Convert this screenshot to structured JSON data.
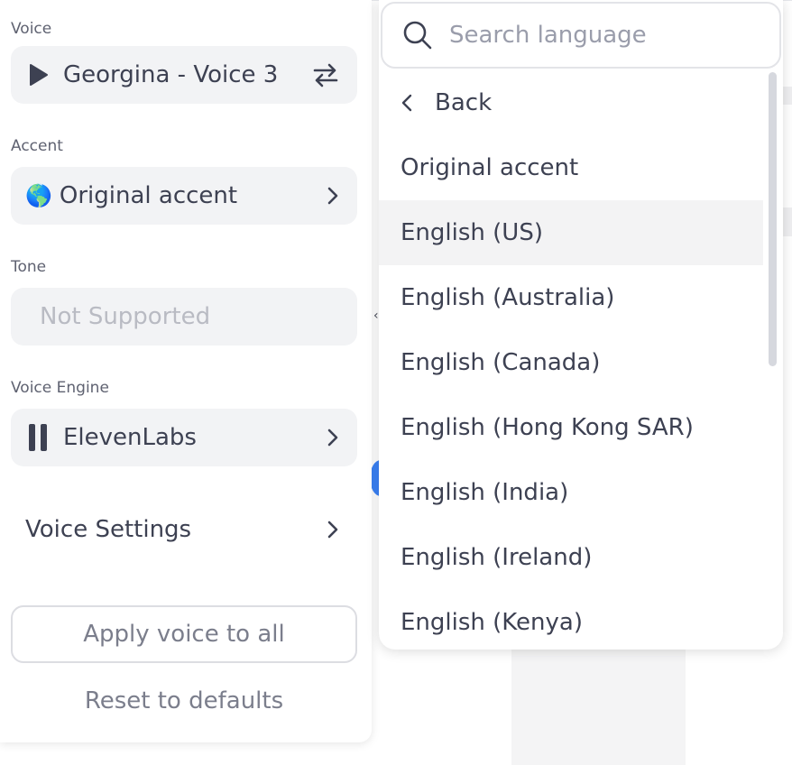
{
  "left_panel": {
    "voice": {
      "label": "Voice",
      "value": "Georgina - Voice 3",
      "icon": "play-icon",
      "action_icon": "swap-icon"
    },
    "accent": {
      "label": "Accent",
      "flag": "🌎",
      "value": "Original accent"
    },
    "tone": {
      "label": "Tone",
      "value": "Not Supported"
    },
    "engine": {
      "label": "Voice Engine",
      "value": "ElevenLabs"
    },
    "settings_label": "Voice Settings",
    "apply_label": "Apply voice to all",
    "reset_label": "Reset to defaults"
  },
  "dropdown": {
    "search_placeholder": "Search language",
    "back_label": "Back",
    "items": [
      "Original accent",
      "English (US)",
      "English (Australia)",
      "English (Canada)",
      "English (Hong Kong SAR)",
      "English (India)",
      "English (Ireland)",
      "English (Kenya)"
    ],
    "highlighted_index": 1
  },
  "colors": {
    "text": "#3d4152",
    "muted": "#7b7e8c",
    "field_bg": "#f2f3f5",
    "highlight_bg": "#f3f3f4",
    "scrollbar": "#d6d8de"
  }
}
